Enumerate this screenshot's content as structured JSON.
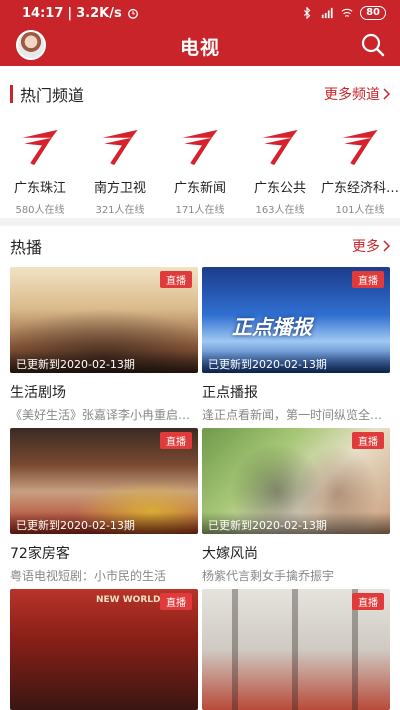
{
  "statusbar": {
    "time": "14:17",
    "speed": "3.2K/s",
    "battery": "80"
  },
  "appbar": {
    "title": "电视"
  },
  "hot_channels": {
    "title": "热门频道",
    "more": "更多频道",
    "items": [
      {
        "name": "广东珠江",
        "count": "580人在线"
      },
      {
        "name": "南方卫视",
        "count": "321人在线"
      },
      {
        "name": "广东新闻",
        "count": "171人在线"
      },
      {
        "name": "广东公共",
        "count": "163人在线"
      },
      {
        "name": "广东经济科…",
        "count": "101人在线"
      }
    ]
  },
  "hot_play": {
    "title": "热播",
    "more": "更多",
    "cards": [
      {
        "badge": "直播",
        "updated": "已更新到2020-02-13期",
        "title": "生活剧场",
        "desc": "《美好生活》张嘉译李小冉重启…"
      },
      {
        "badge": "直播",
        "updated": "已更新到2020-02-13期",
        "title": "正点播报",
        "desc": "逢正点看新闻，第一时间纵览全球…"
      },
      {
        "badge": "直播",
        "updated": "已更新到2020-02-13期",
        "title": "72家房客",
        "desc": "粤语电视短剧：小市民的生活"
      },
      {
        "badge": "直播",
        "updated": "已更新到2020-02-13期",
        "title": "大嫁风尚",
        "desc": "杨紫代言剩女手擒乔振宇"
      },
      {
        "badge": "直播"
      },
      {
        "badge": "直播"
      }
    ],
    "thumb_texts": {
      "card2": "正点播报",
      "card5": "NEW WORLD"
    }
  },
  "colors": {
    "brand": "#c8242a",
    "live": "#e03a3a"
  }
}
